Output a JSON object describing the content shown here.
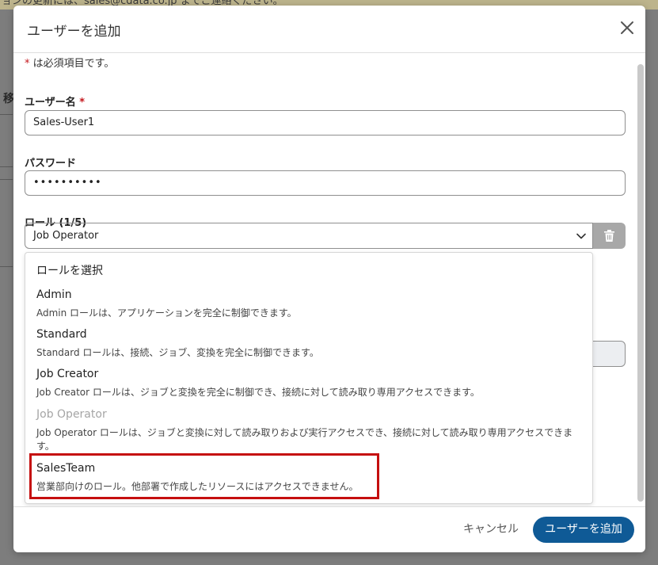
{
  "backdrop": {
    "banner_text": "ョンの更新には、sales@cdata.co.jp までご連絡ください。",
    "side_text": "移"
  },
  "modal": {
    "title": "ユーザーを追加",
    "required_note_star": "*",
    "required_note_text": " は必須項目です。"
  },
  "form": {
    "username_label": "ユーザー名",
    "username_star": "*",
    "username_value": "Sales-User1",
    "password_label": "パスワード",
    "password_value": "••••••••••",
    "role_label": "ロール (1/5)",
    "role_selected": "Job Operator"
  },
  "dropdown": {
    "heading": "ロールを選択",
    "options": [
      {
        "name": "Admin",
        "description": "Admin ロールは、アプリケーションを完全に制御できます。"
      },
      {
        "name": "Standard",
        "description": "Standard ロールは、接続、ジョブ、変換を完全に制御できます。"
      },
      {
        "name": "Job Creator",
        "description": "Job Creator ロールは、ジョブと変換を完全に制御でき、接続に対して読み取り専用アクセスできます。"
      },
      {
        "name": "Job Operator",
        "description": "Job Operator ロールは、ジョブと変換に対して読み取りおよび実行アクセスでき、接続に対して読み取り専用アクセスできます。"
      },
      {
        "name": "SalesTeam",
        "description": "営業部向けのロール。他部署で作成したリソースにはアクセスできません。"
      }
    ]
  },
  "footer": {
    "cancel_label": "キャンセル",
    "submit_label": "ユーザーを追加"
  },
  "colors": {
    "primary": "#0f5a96",
    "required_star": "#c4161c",
    "highlight": "#c50f0f",
    "disabled_text": "#a5a5a5"
  },
  "icons": {
    "close": "close-icon",
    "chevron": "chevron-down-icon",
    "trash": "trash-icon"
  }
}
